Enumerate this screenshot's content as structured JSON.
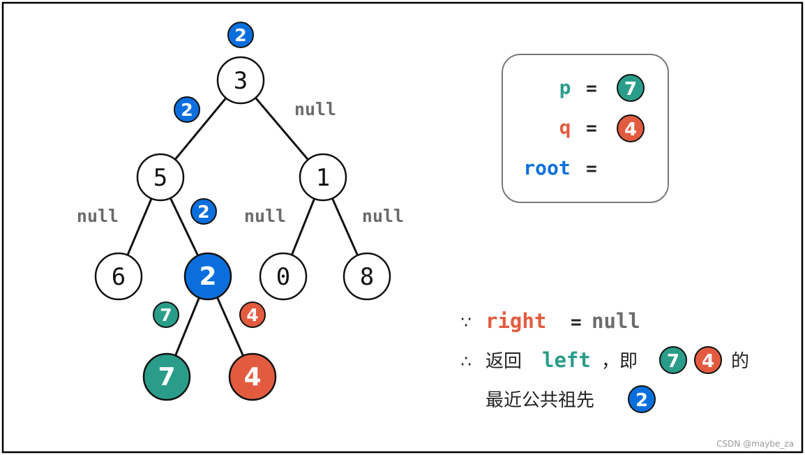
{
  "colors": {
    "blue": "#0a6fdd",
    "teal": "#2a9d8a",
    "red": "#e35b3f",
    "gray": "#6b6b6b",
    "edge": "#111111"
  },
  "tree": {
    "nodes": [
      {
        "id": "3",
        "label": "3",
        "style": "plain"
      },
      {
        "id": "5",
        "label": "5",
        "style": "plain"
      },
      {
        "id": "1",
        "label": "1",
        "style": "plain"
      },
      {
        "id": "6",
        "label": "6",
        "style": "plain"
      },
      {
        "id": "2",
        "label": "2",
        "style": "blue"
      },
      {
        "id": "0",
        "label": "0",
        "style": "plain"
      },
      {
        "id": "8",
        "label": "8",
        "style": "plain"
      },
      {
        "id": "7",
        "label": "7",
        "style": "teal"
      },
      {
        "id": "4",
        "label": "4",
        "style": "red"
      }
    ],
    "edges": [
      [
        "3",
        "5"
      ],
      [
        "3",
        "1"
      ],
      [
        "5",
        "6"
      ],
      [
        "5",
        "2"
      ],
      [
        "1",
        "0"
      ],
      [
        "1",
        "8"
      ],
      [
        "2",
        "7"
      ],
      [
        "2",
        "4"
      ]
    ],
    "return_badges": [
      {
        "at": "3",
        "label": "2",
        "style": "blue"
      },
      {
        "at": "3-5",
        "label": "2",
        "style": "blue"
      },
      {
        "at": "5-2",
        "label": "2",
        "style": "blue"
      },
      {
        "at": "2-7",
        "label": "7",
        "style": "teal"
      },
      {
        "at": "2-4",
        "label": "4",
        "style": "red"
      }
    ],
    "null_labels": [
      {
        "at": "3-1",
        "label": "null"
      },
      {
        "at": "5-6",
        "label": "null"
      },
      {
        "at": "1-0",
        "label": "null"
      },
      {
        "at": "1-8",
        "label": "null"
      }
    ]
  },
  "info_box": {
    "p_label": "p",
    "p_eq": "=",
    "p_value": "7",
    "q_label": "q",
    "q_eq": "=",
    "q_value": "4",
    "root_label": "root",
    "root_eq": "="
  },
  "explanation": {
    "because": "∵",
    "right": "right",
    "eq": "=",
    "null": "null",
    "therefore": "∴",
    "return": "返回",
    "left": "left",
    "comma_ie": "，即",
    "badge_7": "7",
    "badge_4": "4",
    "of": "的",
    "lca": "最近公共祖先",
    "badge_2": "2"
  },
  "watermark": "CSDN @maybe_za"
}
